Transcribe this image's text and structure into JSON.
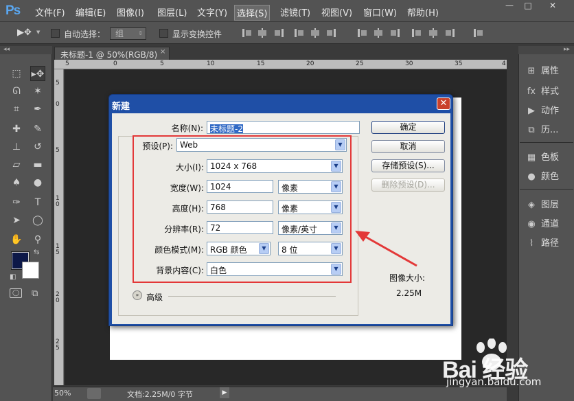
{
  "app": {
    "logo": "Ps"
  },
  "menu": {
    "items": [
      "文件(F)",
      "编辑(E)",
      "图像(I)",
      "图层(L)",
      "文字(Y)",
      "选择(S)",
      "滤镜(T)",
      "视图(V)",
      "窗口(W)",
      "帮助(H)"
    ],
    "active_index": 5
  },
  "window_controls": {
    "minimize": "—",
    "maximize": "□",
    "close": "✕"
  },
  "options_bar": {
    "auto_select_label": "自动选择：",
    "group_value": "组",
    "show_transform_label": "显示变换控件"
  },
  "document": {
    "tab_title": "未标题-1 @ 50%(RGB/8)",
    "tab_close": "×",
    "zoom": "50%",
    "status": "文档:2.25M/0 字节",
    "status_arrow": "▶"
  },
  "ruler": {
    "top_labels": [
      "5",
      "0",
      "5",
      "10",
      "15",
      "20",
      "25",
      "30",
      "35",
      "4"
    ],
    "left_labels": [
      "5",
      "0",
      "5",
      "1 0",
      "1 5",
      "2 0",
      "2 5"
    ]
  },
  "right_panel": {
    "items": [
      {
        "icon": "properties-icon",
        "glyph": "⊞",
        "label": "属性"
      },
      {
        "icon": "styles-icon",
        "glyph": "fx",
        "label": "样式"
      },
      {
        "icon": "actions-icon",
        "glyph": "▶",
        "label": "动作"
      },
      {
        "icon": "history-icon",
        "glyph": "⧉",
        "label": "历..."
      },
      {
        "icon": "swatches-icon",
        "glyph": "▦",
        "label": "色板"
      },
      {
        "icon": "color-icon",
        "glyph": "●",
        "label": "颜色"
      },
      {
        "icon": "layers-icon",
        "glyph": "◈",
        "label": "图层"
      },
      {
        "icon": "channels-icon",
        "glyph": "◉",
        "label": "通道"
      },
      {
        "icon": "paths-icon",
        "glyph": "⌇",
        "label": "路径"
      }
    ]
  },
  "dialog": {
    "title": "新建",
    "close": "✕",
    "name_label": "名称(N):",
    "name_value": "未标题-2",
    "preset_label": "预设(P):",
    "preset_value": "Web",
    "size_label": "大小(I):",
    "size_value": "1024 x 768",
    "width_label": "宽度(W):",
    "width_value": "1024",
    "width_unit": "像素",
    "height_label": "高度(H):",
    "height_value": "768",
    "height_unit": "像素",
    "resolution_label": "分辨率(R):",
    "resolution_value": "72",
    "resolution_unit": "像素/英寸",
    "color_mode_label": "颜色模式(M):",
    "color_mode_value": "RGB 颜色",
    "bit_depth_value": "8 位",
    "bg_label": "背景内容(C):",
    "bg_value": "白色",
    "advanced_label": "高级",
    "advanced_icon": "»",
    "ok_button": "确定",
    "cancel_button": "取消",
    "save_preset_button": "存储预设(S)...",
    "delete_preset_button": "删除预设(D)...",
    "image_size_label": "图像大小:",
    "image_size_value": "2.25M",
    "dropdown_glyph": "▼"
  },
  "watermark": {
    "brand": "Bai 经验",
    "url": "jingyan.baidu.com"
  },
  "colors": {
    "ui_gray": "#535353",
    "dialog_blue": "#1f4fa6",
    "highlight_red": "#e33838",
    "foreground": "#0d1848"
  }
}
